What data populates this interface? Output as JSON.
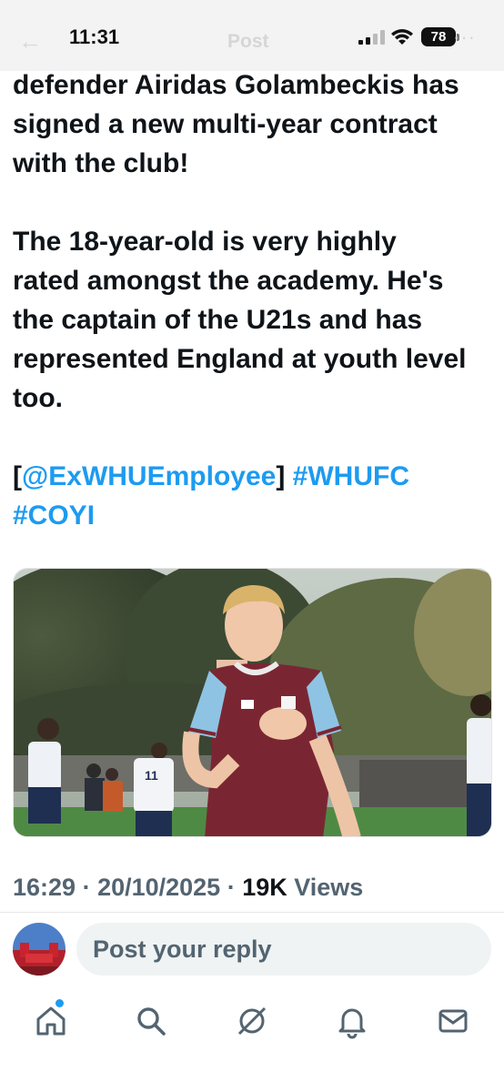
{
  "status_bar": {
    "time": "11:31",
    "battery": "78",
    "header_title": "Post"
  },
  "tweet": {
    "lines": [
      "defender Airidas Golambeckis has",
      "signed a new multi-year contract",
      "with the club!",
      "The 18-year-old is very highly",
      "rated amongst the academy. He's",
      "the captain of the U21s and has",
      "represented England at youth level",
      "too."
    ],
    "bracket_open": "[",
    "mention": "@ExWHUEmployee",
    "bracket_close": "]",
    "hashtag_1": "#WHUFC",
    "hashtag_2": "#COYI",
    "shirt_number": "11"
  },
  "meta": {
    "time": "16:29",
    "separator": " · ",
    "date": "20/10/2025",
    "views_count": "19K",
    "views_label": "Views"
  },
  "reply": {
    "placeholder": "Post your reply"
  },
  "tab_bar": {
    "items": [
      "home-icon",
      "search-icon",
      "grok-icon",
      "notifications-icon",
      "messages-icon"
    ]
  },
  "colors": {
    "link": "#1d9bf0",
    "text": "#0f1419",
    "muted": "#536471",
    "input_bg": "#eff3f4",
    "claret": "#7a2632",
    "sky_blue": "#8fc3e3"
  }
}
